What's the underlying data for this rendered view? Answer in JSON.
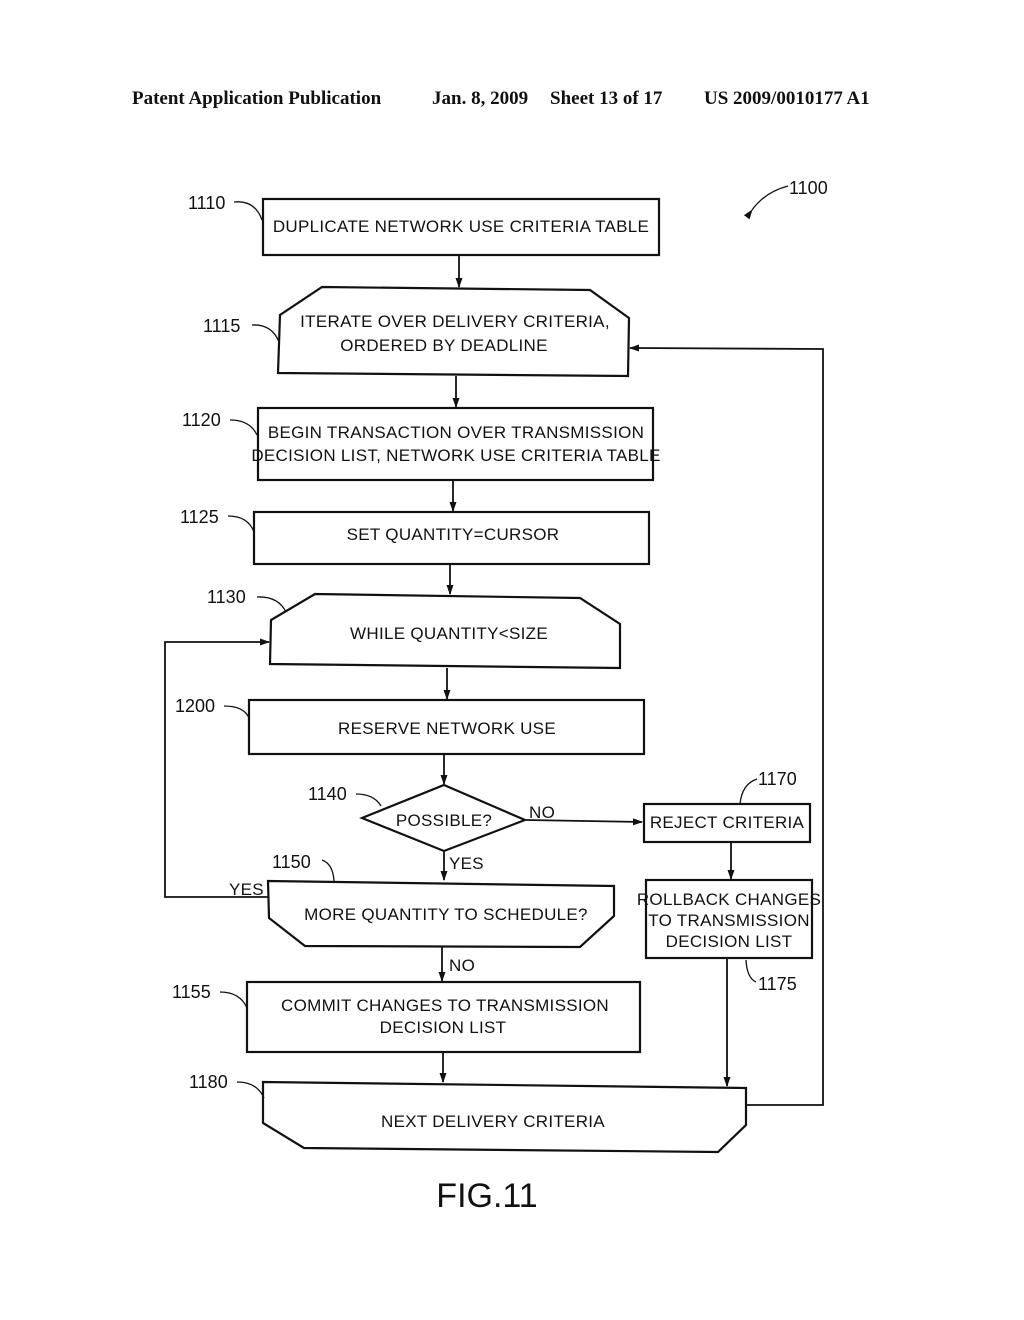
{
  "header": {
    "publication": "Patent Application Publication",
    "date": "Jan. 8, 2009",
    "sheet": "Sheet 13 of 17",
    "number": "US 2009/0010177 A1"
  },
  "diagram": {
    "ref": "1100",
    "figure_label": "FIG.11",
    "nodes": [
      {
        "id": "1110",
        "type": "process",
        "lines": [
          "DUPLICATE NETWORK USE CRITERIA TABLE"
        ]
      },
      {
        "id": "1115",
        "type": "loop-start",
        "lines": [
          "ITERATE OVER DELIVERY CRITERIA,",
          "ORDERED BY DEADLINE"
        ]
      },
      {
        "id": "1120",
        "type": "process",
        "lines": [
          "BEGIN TRANSACTION OVER TRANSMISSION",
          "DECISION LIST, NETWORK USE CRITERIA TABLE"
        ]
      },
      {
        "id": "1125",
        "type": "process",
        "lines": [
          "SET QUANTITY=CURSOR"
        ]
      },
      {
        "id": "1130",
        "type": "loop-start",
        "lines": [
          "WHILE QUANTITY<SIZE"
        ]
      },
      {
        "id": "1200",
        "type": "process",
        "lines": [
          "RESERVE NETWORK USE"
        ]
      },
      {
        "id": "1140",
        "type": "decision",
        "lines": [
          "POSSIBLE?"
        ]
      },
      {
        "id": "1170",
        "type": "process",
        "lines": [
          "REJECT CRITERIA"
        ]
      },
      {
        "id": "1175",
        "type": "process",
        "lines": [
          "ROLLBACK CHANGES",
          "TO TRANSMISSION",
          "DECISION LIST"
        ]
      },
      {
        "id": "1150",
        "type": "loop-end",
        "lines": [
          "MORE QUANTITY TO SCHEDULE?"
        ]
      },
      {
        "id": "1155",
        "type": "process",
        "lines": [
          "COMMIT CHANGES TO TRANSMISSION",
          "DECISION LIST"
        ]
      },
      {
        "id": "1180",
        "type": "loop-end",
        "lines": [
          "NEXT DELIVERY CRITERIA"
        ]
      }
    ],
    "edge_labels": {
      "possible_no": "NO",
      "possible_yes": "YES",
      "more_yes": "YES",
      "more_no": "NO"
    },
    "edges": [
      {
        "from": "1110",
        "to": "1115"
      },
      {
        "from": "1115",
        "to": "1120"
      },
      {
        "from": "1120",
        "to": "1125"
      },
      {
        "from": "1125",
        "to": "1130"
      },
      {
        "from": "1130",
        "to": "1200"
      },
      {
        "from": "1200",
        "to": "1140"
      },
      {
        "from": "1140",
        "to": "1150",
        "label": "YES"
      },
      {
        "from": "1140",
        "to": "1170",
        "label": "NO"
      },
      {
        "from": "1170",
        "to": "1175"
      },
      {
        "from": "1175",
        "to": "1180"
      },
      {
        "from": "1150",
        "to": "1130",
        "label": "YES"
      },
      {
        "from": "1150",
        "to": "1155",
        "label": "NO"
      },
      {
        "from": "1155",
        "to": "1180"
      },
      {
        "from": "1180",
        "to": "1115"
      }
    ]
  }
}
